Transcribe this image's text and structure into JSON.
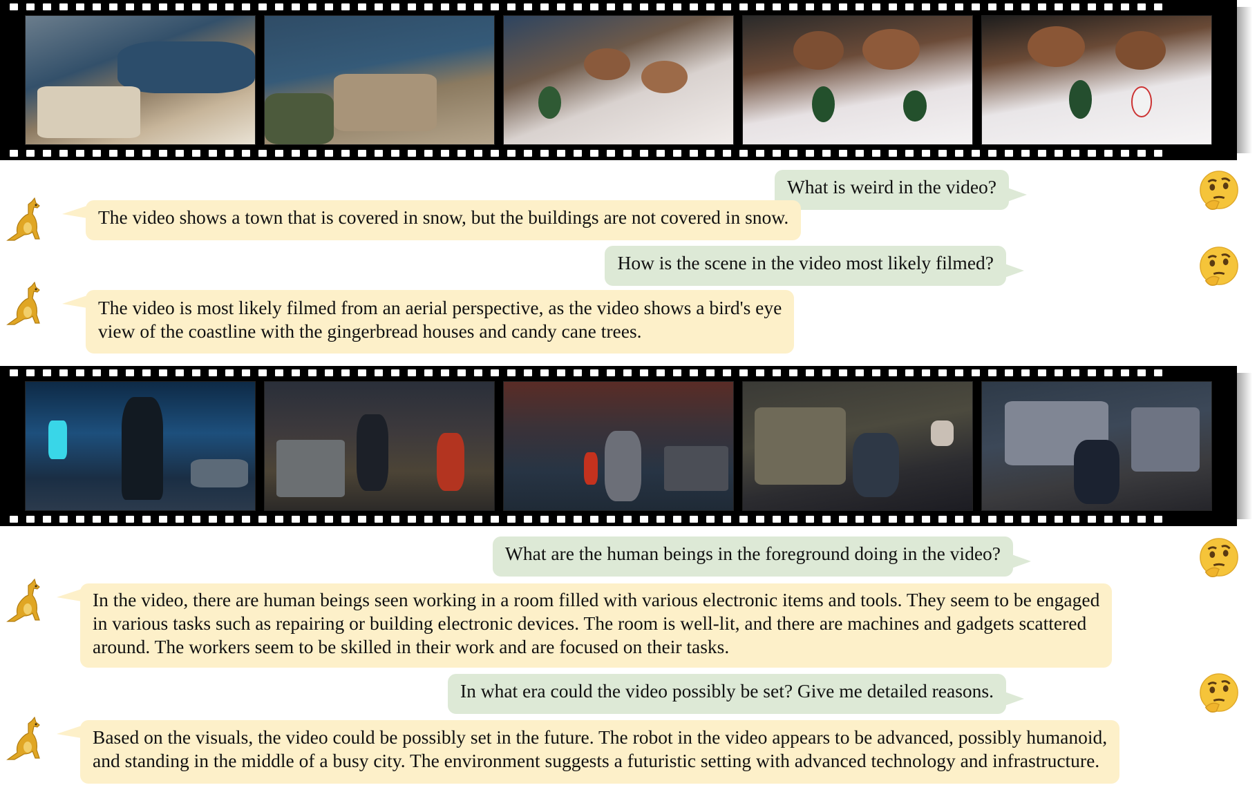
{
  "colors": {
    "user_bubble": "#dde9d6",
    "bot_bubble": "#fdf0c9",
    "film": "#000000"
  },
  "icons": {
    "user": "thinking-face-icon",
    "assistant": "kangaroo-icon"
  },
  "conversations": [
    {
      "video": "coastline-to-gingerbread-village",
      "turns": [
        {
          "question": "What is weird in the video?",
          "answer": [
            "The video shows a town that is covered in snow, but the buildings are not covered in snow."
          ]
        },
        {
          "question": "How is the scene in the video most likely filmed?",
          "answer": [
            "The video is most likely filmed from an aerial perspective, as the video shows a bird's eye",
            "view of the coastline with the gingerbread houses and candy cane trees."
          ]
        }
      ]
    },
    {
      "video": "robot-in-futuristic-city",
      "turns": [
        {
          "question": "What are the human beings in the foreground doing in the video?",
          "answer": [
            "In the video, there are human beings seen working in a room filled with various electronic items and tools. They seem to be engaged",
            "in various tasks such as repairing or building electronic devices. The room is well-lit, and there are machines and gadgets scattered",
            "around. The workers seem to be skilled in their work and are focused on their tasks."
          ]
        },
        {
          "question": "In what era could the video possibly be set? Give me detailed reasons.",
          "answer": [
            "Based on the visuals, the video could be possibly set in the future. The robot in the video appears to be advanced, possibly humanoid,",
            "and standing in the middle of a busy city. The environment suggests a futuristic setting with advanced technology and infrastructure."
          ]
        }
      ]
    }
  ]
}
